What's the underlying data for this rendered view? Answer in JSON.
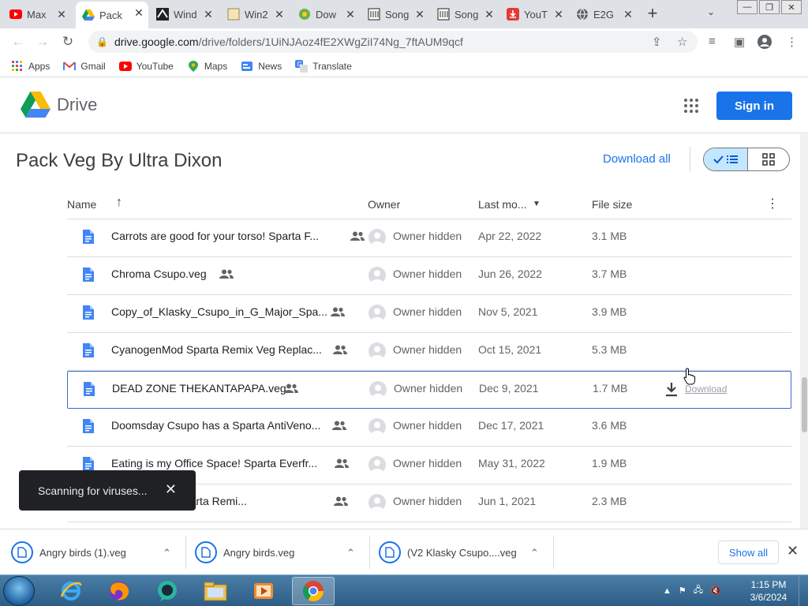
{
  "browser": {
    "tabs": [
      {
        "title": "Max",
        "icon": "youtube-icon"
      },
      {
        "title": "Pack",
        "icon": "google-drive-icon",
        "active": true
      },
      {
        "title": "Wind",
        "icon": "wink-icon"
      },
      {
        "title": "Win2",
        "icon": "page-icon"
      },
      {
        "title": "Dow",
        "icon": "download-site-icon"
      },
      {
        "title": "Song",
        "icon": "archive-icon"
      },
      {
        "title": "Song",
        "icon": "archive-icon"
      },
      {
        "title": "YouT",
        "icon": "download-icon"
      },
      {
        "title": "E2G",
        "icon": "globe-icon"
      }
    ],
    "url_host": "drive.google.com",
    "url_path": "/drive/folders/1UiNJAoz4fE2XWgZiI74Ng_7ftAUM9qcf",
    "bookmarks": [
      {
        "label": "Apps",
        "icon": "apps-grid-icon"
      },
      {
        "label": "Gmail",
        "icon": "gmail-icon"
      },
      {
        "label": "YouTube",
        "icon": "youtube-icon"
      },
      {
        "label": "Maps",
        "icon": "maps-icon"
      },
      {
        "label": "News",
        "icon": "news-icon"
      },
      {
        "label": "Translate",
        "icon": "translate-icon"
      }
    ]
  },
  "drive": {
    "logo_text": "Drive",
    "signin_label": "Sign in",
    "folder_title": "Pack Veg By Ultra Dixon",
    "download_all_label": "Download all",
    "columns": {
      "name": "Name",
      "owner": "Owner",
      "modified": "Last mo...",
      "size": "File size"
    },
    "files": [
      {
        "name": "Carrots are good for your torso! Sparta F...",
        "owner": "Owner hidden",
        "modified": "Apr 22, 2022",
        "size": "3.1 MB"
      },
      {
        "name": "Chroma Csupo.veg",
        "owner": "Owner hidden",
        "modified": "Jun 26, 2022",
        "size": "3.7 MB"
      },
      {
        "name": "Copy_of_Klasky_Csupo_in_G_Major_Spa...",
        "owner": "Owner hidden",
        "modified": "Nov 5, 2021",
        "size": "3.9 MB"
      },
      {
        "name": "CyanogenMod Sparta Remix Veg Replac...",
        "owner": "Owner hidden",
        "modified": "Oct 15, 2021",
        "size": "5.3 MB"
      },
      {
        "name": "DEAD ZONE THEKANTAPAPA.veg",
        "owner": "Owner hidden",
        "modified": "Dec 9, 2021",
        "size": "1.7 MB",
        "hover_action": "Download"
      },
      {
        "name": "Doomsday Csupo has a Sparta AntiVeno...",
        "owner": "Owner hidden",
        "modified": "Dec 17, 2021",
        "size": "3.6 MB"
      },
      {
        "name": "Eating is my Office Space! Sparta Everfr...",
        "owner": "Owner hidden",
        "modified": "May 31, 2022",
        "size": "1.9 MB"
      },
      {
        "name": "stom Source Sparta Remi...",
        "owner": "Owner hidden",
        "modified": "Jun 1, 2021",
        "size": "2.3 MB"
      }
    ]
  },
  "toast": {
    "message": "Scanning for viruses..."
  },
  "downloads": {
    "items": [
      "Angry birds (1).veg",
      "Angry birds.veg",
      "(V2 Klasky Csupo....veg"
    ],
    "show_all_label": "Show all"
  },
  "taskbar": {
    "apps": [
      "internet-explorer-icon",
      "firefox-icon",
      "chat-app-icon",
      "file-explorer-icon",
      "media-player-icon",
      "chrome-icon"
    ],
    "time": "1:15 PM",
    "date": "3/6/2024"
  },
  "colors": {
    "accent": "#1a73e8",
    "selected_view": "#c2e7ff",
    "toast_bg": "#202124"
  }
}
